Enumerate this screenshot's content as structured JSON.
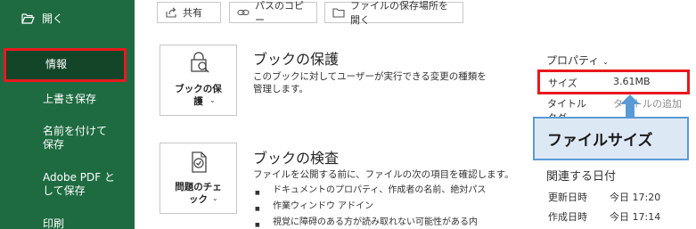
{
  "sidebar": {
    "open_label": "開く",
    "selected_label": "情報",
    "items": [
      {
        "label": "上書き保存"
      },
      {
        "label": "名前を付けて保存"
      },
      {
        "label": "Adobe PDF として保存"
      },
      {
        "label": "印刷"
      }
    ]
  },
  "toolbar": {
    "share_label": "共有",
    "copy_path_label": "パスのコピー",
    "open_location_label": "ファイルの保存場所を開く"
  },
  "protect": {
    "tile_label": "ブックの保護",
    "title": "ブックの保護",
    "description": "このブックに対してユーザーが実行できる変更の種類を管理します。"
  },
  "inspect": {
    "tile_label": "問題のチェック",
    "title": "ブックの検査",
    "description": "ファイルを公開する前に、ファイルの次の項目を確認します。",
    "bullets": [
      "ドキュメントのプロパティ、作成者の名前、絶対パス",
      "作業ウィンドウ アドイン",
      "視覚に障碍のある方が読み取れない可能性がある内"
    ]
  },
  "properties": {
    "heading": "プロパティ",
    "size_label": "サイズ",
    "size_value": "3.61MB",
    "title_label": "タイトル",
    "title_value": "タイトルの追加",
    "partial_label": "タグ"
  },
  "dates": {
    "heading": "関連する日付",
    "modified_label": "更新日時",
    "modified_value": "今日 17:20",
    "created_label": "作成日時",
    "created_value": "今日 17:14"
  },
  "callout": {
    "label": "ファイルサイズ"
  },
  "colors": {
    "sidebar_bg": "#1e6b41",
    "sidebar_selected_bg": "#134528",
    "highlight_red": "#e8191e",
    "callout_bg": "#dde8f5",
    "callout_border": "#5b9bd5"
  },
  "icons": {
    "open": "folder-open-icon",
    "share": "share-icon",
    "copy_path": "link-icon",
    "open_location": "folder-icon",
    "protect": "lock-magnifier-icon",
    "inspect": "document-check-icon",
    "arrow": "arrow-up-icon"
  }
}
